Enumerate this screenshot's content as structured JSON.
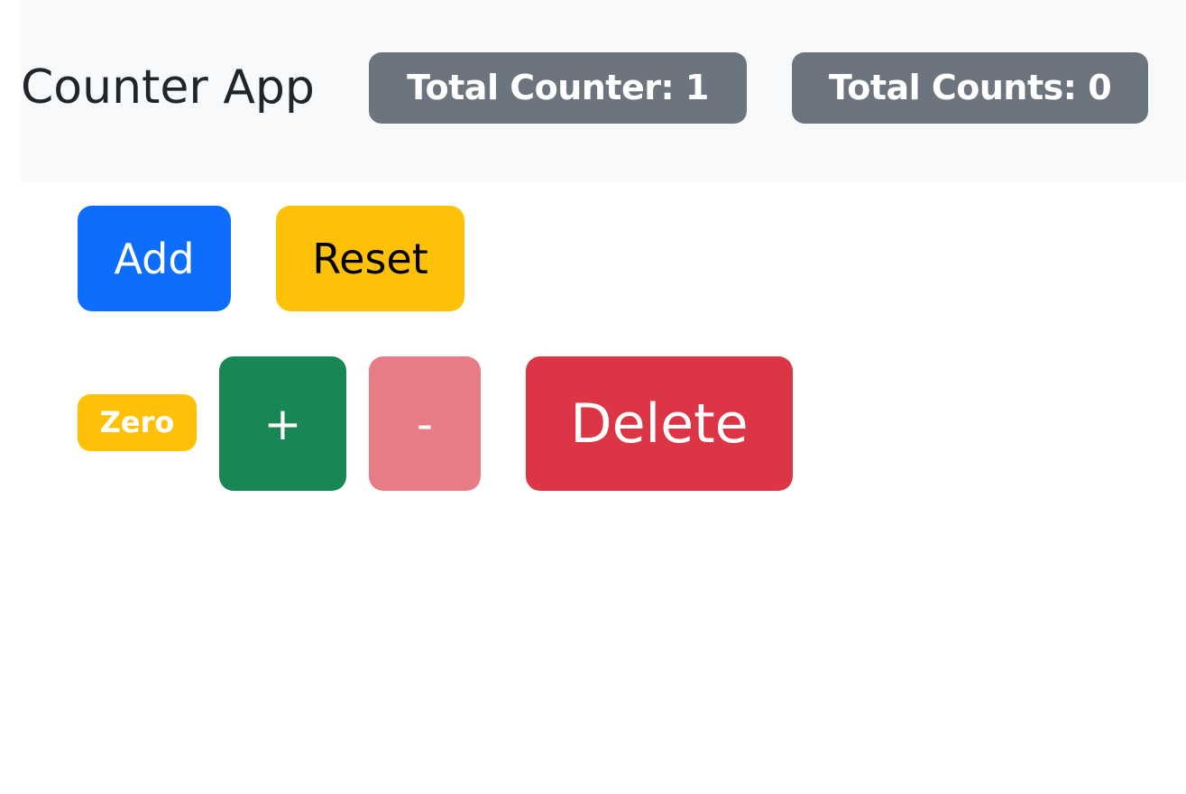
{
  "header": {
    "title": "Counter App",
    "total_counter": "Total Counter: 1",
    "total_counts": "Total Counts: 0"
  },
  "controls": {
    "add_label": "Add",
    "reset_label": "Reset"
  },
  "counters": [
    {
      "value_label": "Zero",
      "increment_label": "+",
      "decrement_label": "-",
      "delete_label": "Delete"
    }
  ],
  "colors": {
    "primary": "#0d6efd",
    "warning": "#ffc107",
    "success": "#198754",
    "danger": "#dc3545",
    "secondary": "#6c757d",
    "navbar_bg": "#f8f9fa"
  }
}
